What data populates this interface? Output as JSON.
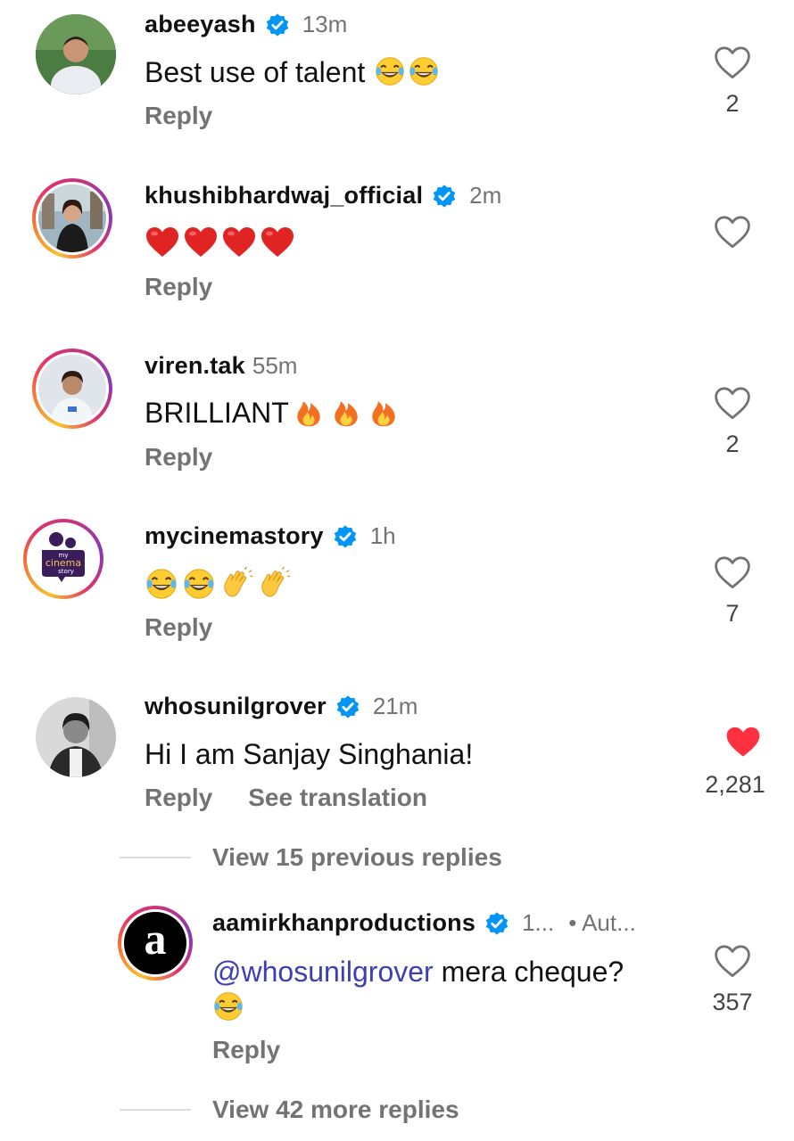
{
  "comments": [
    {
      "username": "abeeyash",
      "verified": true,
      "time": "13m",
      "text": "Best use of talent",
      "emojis": [
        "laugh-cry",
        "laugh-cry"
      ],
      "reply": "Reply",
      "likes": "2",
      "liked": false
    },
    {
      "username": "khushibhardwaj_official",
      "verified": true,
      "time": "2m",
      "text": "",
      "emojis": [
        "red-heart",
        "red-heart",
        "red-heart",
        "red-heart"
      ],
      "reply": "Reply",
      "likes": "",
      "liked": false
    },
    {
      "username": "viren.tak",
      "verified": false,
      "time": "55m",
      "text": "BRILLIANT",
      "emojis": [
        "fire",
        "fire",
        "fire"
      ],
      "reply": "Reply",
      "likes": "2",
      "liked": false
    },
    {
      "username": "mycinemastory",
      "verified": true,
      "time": "1h",
      "text": "",
      "emojis": [
        "laugh-cry",
        "laugh-cry",
        "clapping-hands",
        "clapping-hands"
      ],
      "reply": "Reply",
      "likes": "7",
      "liked": false,
      "avatar_text": [
        "my",
        "cinema",
        "story"
      ]
    },
    {
      "username": "whosunilgrover",
      "verified": true,
      "time": "21m",
      "text": "Hi I am Sanjay Singhania!",
      "emojis": [],
      "reply": "Reply",
      "see_translation": "See translation",
      "likes": "2,281",
      "liked": true
    }
  ],
  "view_previous": "View 15 previous replies",
  "reply_comment": {
    "username": "aamirkhanproductions",
    "verified": true,
    "time": "1...",
    "extra": "• Aut...",
    "mention": "@whosunilgrover",
    "text": " mera cheque?",
    "emojis": [
      "laugh-cry"
    ],
    "reply": "Reply",
    "likes": "357",
    "liked": false,
    "avatar_letter": "a"
  },
  "view_more": "View 42 more replies",
  "colors": {
    "verified": "#0095f6",
    "like_red": "#ff3040",
    "mention": "#3d3fb3",
    "muted": "#737373"
  }
}
